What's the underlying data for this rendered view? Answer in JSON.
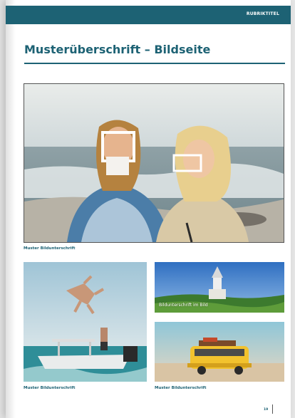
{
  "header": {
    "section_label": "RUBRIKTITEL"
  },
  "page": {
    "title": "Musterüberschrift – Bildseite",
    "page_number": "19"
  },
  "images": {
    "main": {
      "caption": "Muster Bildunterschrift"
    },
    "jump": {
      "caption": "Muster Bildunterschrift"
    },
    "church": {
      "overlay_caption": "Bildunterschrift im Bild"
    },
    "bus": {
      "caption": "Muster Bildunterschrift"
    }
  },
  "colors": {
    "accent": "#1d6274",
    "page_background": "#ffffff"
  }
}
